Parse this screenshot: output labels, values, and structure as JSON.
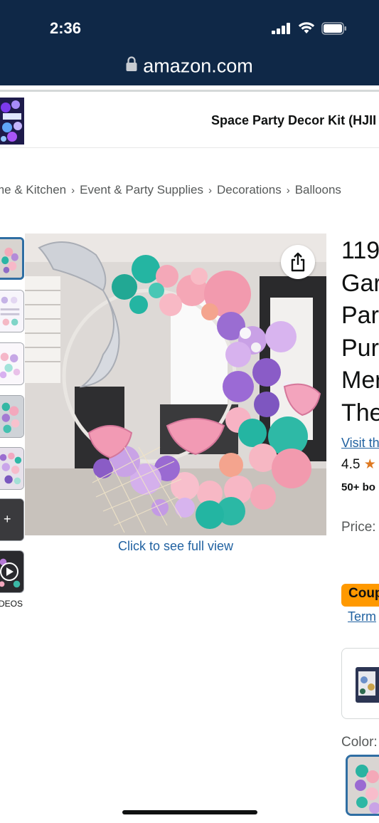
{
  "status_bar": {
    "time": "2:36"
  },
  "browser": {
    "url": "amazon.com"
  },
  "sticky_bar": {
    "product_title": "Space Party Decor Kit (HJII"
  },
  "breadcrumb": {
    "items": [
      "me & Kitchen",
      "Event & Party Supplies",
      "Decorations",
      "Balloons"
    ],
    "separator": "›"
  },
  "gallery": {
    "thumbnails": [
      "balloon garland",
      "balloon color chart",
      "balloon set",
      "balloon arch",
      "balloon pack",
      "more images",
      "video"
    ],
    "more_label": "+",
    "videos_label": "DEOS",
    "full_view_link": "Click to see full view",
    "share_icon": "share-icon"
  },
  "product": {
    "title_lines": [
      "119",
      "Gar",
      "Par",
      "Pur",
      "Mer",
      "The"
    ],
    "visit_store": "Visit th",
    "rating_value": "4.5",
    "bought": "50+ bo",
    "price_label": "Price:",
    "coupon_label": "Coup",
    "terms_link": "Term",
    "color_label": "Color:"
  },
  "colors": {
    "header_bg": "#0f2847",
    "link": "#2162a1",
    "star": "#de7921",
    "coupon_bg": "#ff9900",
    "selected_border": "#2f6ea3"
  }
}
